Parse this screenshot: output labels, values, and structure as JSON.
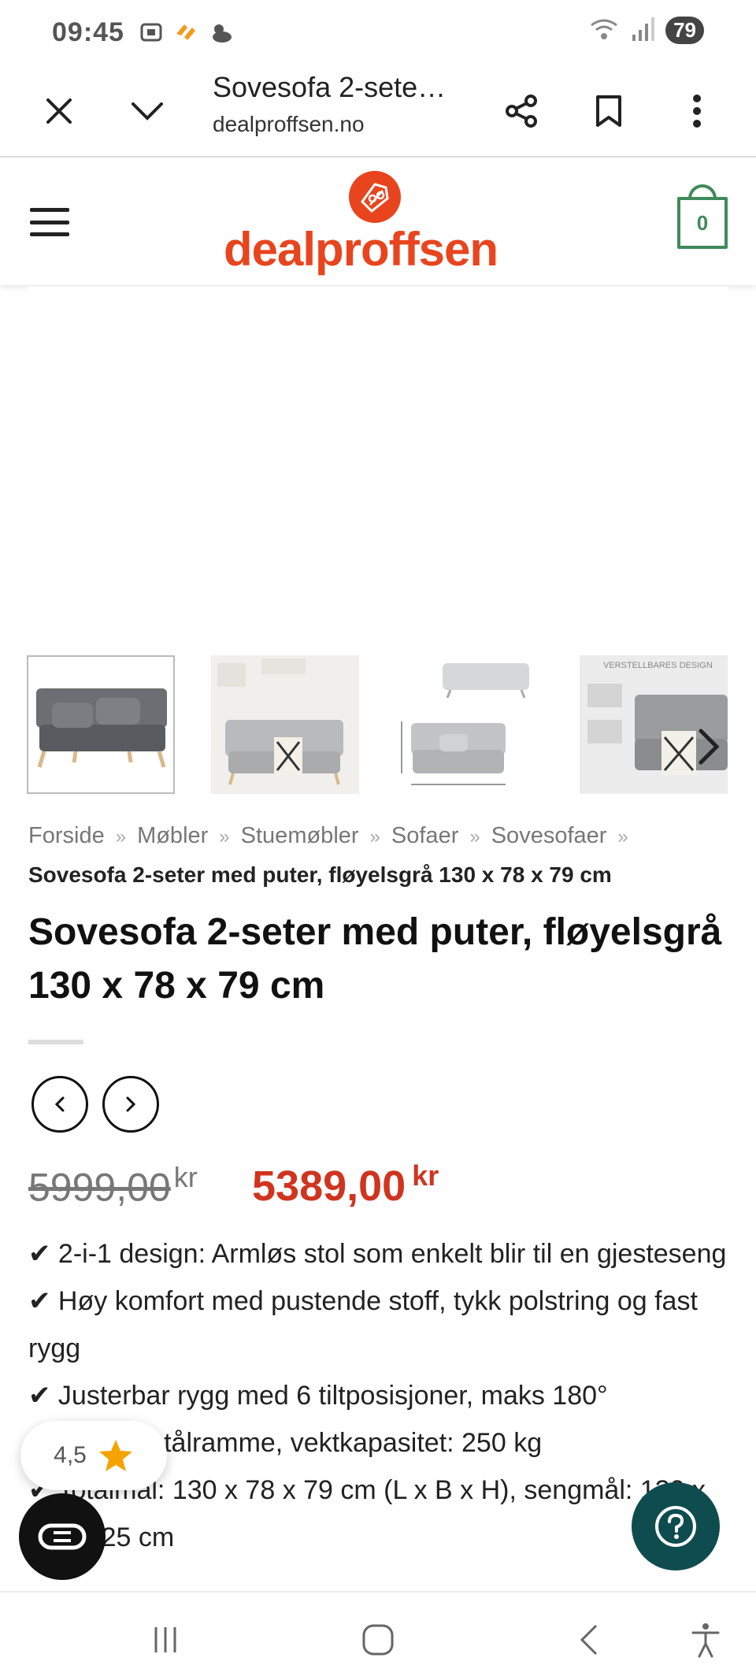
{
  "status": {
    "time": "09:45",
    "battery": "79"
  },
  "browser": {
    "title": "Sovesofa 2-sete…",
    "url": "dealproffsen.no"
  },
  "site": {
    "logo_text": "dealproffsen",
    "cart_count": "0",
    "brand_color": "#e8451e",
    "cart_color": "#3f8a5a"
  },
  "breadcrumb": {
    "items": [
      "Forside",
      "Møbler",
      "Stuemøbler",
      "Sofaer",
      "Sovesofaer"
    ],
    "separator": "»",
    "current": "Sovesofa 2-seter med puter, fløyelsgrå 130 x 78 x 79 cm"
  },
  "product": {
    "title": "Sovesofa 2-seter med puter, fløyelsgrå 130 x 78 x 79 cm",
    "old_price": "5999,00",
    "new_price": "5389,00",
    "currency": "kr",
    "features": [
      "✔ 2-i-1 design: Armløs stol som enkelt blir til en gjesteseng",
      "✔ Høy komfort med pustende stoff, tykk polstring og fast rygg",
      "✔ Justerbar rygg med 6 tiltposisjoner, maks 180°",
      "✔ Robust stålramme, vektkapasitet: 250 kg",
      "✔ Totalmål: 130 x 78 x 79 cm (L x B x H), sengmål: 130 x 190 x 25 cm"
    ]
  },
  "thumbnail_labels": {
    "third_top_left": "",
    "fourth_banner": "VERSTELLBARES DESIGN"
  },
  "rating": {
    "value": "4,5"
  }
}
